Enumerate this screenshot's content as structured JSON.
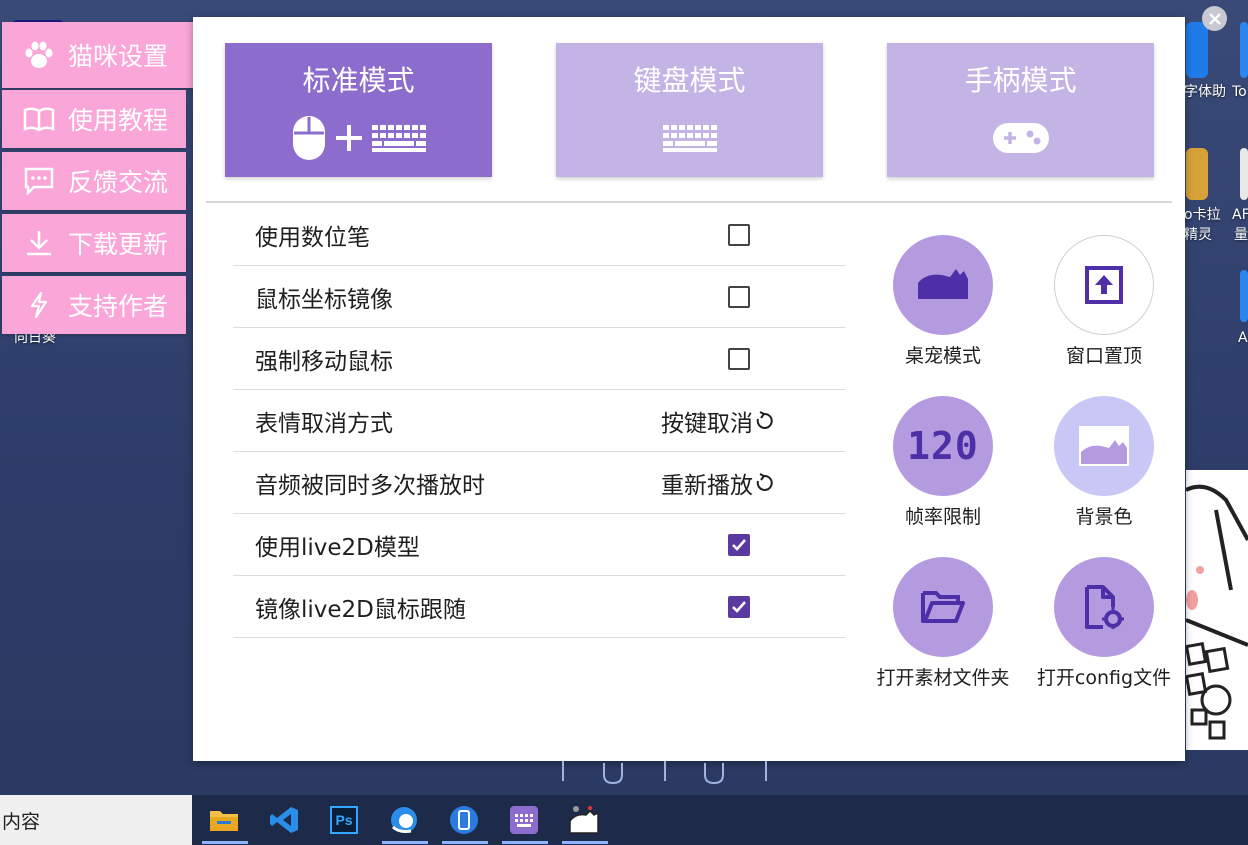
{
  "colors": {
    "mode_active": "#8c6ccc",
    "mode_idle": "#c3b4e5",
    "side_menu": "#fba6d8",
    "tool_circle": "#b49be0",
    "tool_circle_light": "#c9c7f5",
    "accent_dark": "#4f2fa8",
    "checkbox_checked": "#5a3aa0"
  },
  "side_menu": [
    {
      "label": "猫咪设置",
      "icon": "paw-icon"
    },
    {
      "label": "使用教程",
      "icon": "book-icon"
    },
    {
      "label": "反馈交流",
      "icon": "chat-icon"
    },
    {
      "label": "下载更新",
      "icon": "download-icon"
    },
    {
      "label": "支持作者",
      "icon": "lightning-icon"
    }
  ],
  "modes": [
    {
      "label": "标准模式",
      "icon": "mouse-plus-keyboard-icon",
      "active": true
    },
    {
      "label": "键盘模式",
      "icon": "keyboard-icon",
      "active": false
    },
    {
      "label": "手柄模式",
      "icon": "gamepad-icon",
      "active": false
    }
  ],
  "settings": [
    {
      "name": "使用数位笔",
      "type": "checkbox",
      "checked": false
    },
    {
      "name": "鼠标坐标镜像",
      "type": "checkbox",
      "checked": false
    },
    {
      "name": "强制移动鼠标",
      "type": "checkbox",
      "checked": false
    },
    {
      "name": "表情取消方式",
      "type": "cycle",
      "value": "按键取消"
    },
    {
      "name": "音频被同时多次播放时",
      "type": "cycle",
      "value": "重新播放"
    },
    {
      "name": "使用live2D模型",
      "type": "checkbox",
      "checked": true
    },
    {
      "name": "镜像live2D鼠标跟随",
      "type": "checkbox",
      "checked": true
    }
  ],
  "tools": [
    {
      "label": "桌宠模式",
      "icon": "cat-silhouette-icon"
    },
    {
      "label": "窗口置顶",
      "icon": "pin-top-icon"
    },
    {
      "label": "帧率限制",
      "icon": "fps-120-icon",
      "text": "120"
    },
    {
      "label": "背景色",
      "icon": "background-color-icon"
    },
    {
      "label": "打开素材文件夹",
      "icon": "folder-open-icon"
    },
    {
      "label": "打开config文件",
      "icon": "file-settings-icon"
    }
  ],
  "desktop": {
    "icon_labels": [
      "字体助",
      "To",
      "o卡拉",
      "精灵",
      "AF",
      "量",
      "A",
      "向日葵"
    ]
  },
  "taskbar": {
    "search_text": "内容",
    "apps": [
      "file-explorer-icon",
      "vscode-icon",
      "photoshop-icon",
      "browser-icon",
      "phone-icon",
      "keyboard-app-icon",
      "bongo-cat-icon"
    ],
    "ps_text": "Ps"
  }
}
